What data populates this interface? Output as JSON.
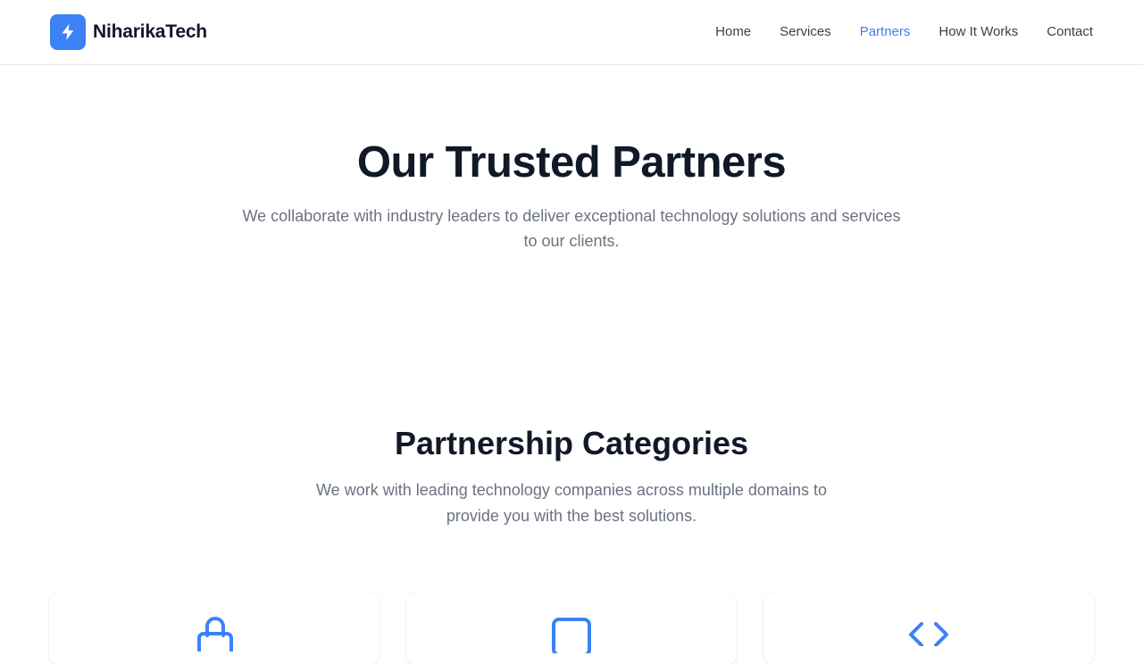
{
  "header": {
    "brand_name": "NiharikaTech",
    "brand_icon": "lightning-bolt-icon",
    "nav": [
      {
        "label": "Home",
        "active": false
      },
      {
        "label": "Services",
        "active": false
      },
      {
        "label": "Partners",
        "active": true
      },
      {
        "label": "How It Works",
        "active": false
      },
      {
        "label": "Contact",
        "active": false
      }
    ]
  },
  "hero": {
    "title": "Our Trusted Partners",
    "subtitle": "We collaborate with industry leaders to deliver exceptional technology solutions and services to our clients."
  },
  "categories": {
    "title": "Partnership Categories",
    "subtitle": "We work with leading technology companies across multiple domains to provide you with the best solutions.",
    "cards": [
      {
        "icon": "lock-icon"
      },
      {
        "icon": "square-icon"
      },
      {
        "icon": "code-icon"
      }
    ]
  },
  "colors": {
    "accent": "#3b82f6",
    "heading": "#111827",
    "muted": "#6b7280",
    "nav_text": "#374151",
    "border": "#e5e7eb"
  }
}
